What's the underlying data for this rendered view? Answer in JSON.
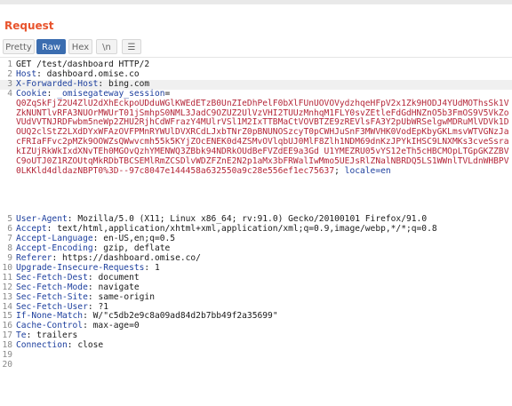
{
  "panel": {
    "title": "Request"
  },
  "toolbar": {
    "pretty_label": "Pretty",
    "raw_label": "Raw",
    "hex_label": "Hex",
    "newline_label": "\\n",
    "menu_label": "☰"
  },
  "request": {
    "request_line": "GET /test/dashboard HTTP/2",
    "headers": [
      {
        "num": "2",
        "name": "Host",
        "value": "dashboard.omise.co"
      },
      {
        "num": "3",
        "name": "X-Forwarded-Host",
        "value": "bing.com"
      }
    ],
    "cookie_name": "Cookie",
    "cookie_key": "_omisegateway_session",
    "cookie_value": "Q0ZqSkFjZ2U4ZlU2dXhEckpoUDduWGlKWEdETzB0UnZIeDhPelF0bXlFUnUOVOVydzhqeHFpV2x1Zk9HODJ4YUdMOThsSk1VZkNUNTlvRFA3NUOrMWUrT01jSmhpS0NML3JadC9OZUZ2UlVzVHI2TUUzMnhqM1FLY0svZEtleFdGdHNZnO5b3FmOS9V5VkZoVUdVVTNJRDFwbm5neWp2ZHU2RjhCdWFrazY4MUlrVSl1M2IxTTBMaCtVOVBTZE9zREVlsFA3Y2pUbWRSelgwMDRuMlVDVk1DOUQ2clStZ2LXdDYxWFAzOVFPMnRYWUlDVXRCdLJxbTNrZ0pBNUNOSzcyT0pCWHJuSnF3MWVHK0VodEpKbyGKLmsvWTVGNzJacFRIaFFvc2pMZk9OOWZsQWwvcmh55k5KYjZOcENEK0d4ZSMvOVlqbUJ0MlF8Zlh1NDM69dnKzJPYkIHSC9LNXMKs3cveSsrakIZUjRkWkIxdXNvTEh0MGOvQzhYMENWQ3ZBbk94NDRkOUdBeFVZdEE9a3Gd U1YMEZRU05vYS12eTh5cHBCMOpLTGpGKZZBVC9oUTJ0Z1RZOUtqMkRDbTBCSEMlRmZCSDlvWDZFZnE2N2p1aMx3bFRWalIwMmo5UEJsRlZNalNBRDQ5LS1WWnlTVLdnWHBPV0LKKld4dldaz"
  },
  "cookie_extra": [
    "NBPT0%3D--97c8047e144458a632550a9c28e556ef1ec75637",
    "locale=en"
  ],
  "headers_after": [
    {
      "num": "5",
      "name": "User-Agent",
      "value": "Mozilla/5.0 (X11; Linux x86_64; rv:91.0) Gecko/20100101 Firefox/91.0"
    },
    {
      "num": "6",
      "name": "Accept",
      "value": "text/html,application/xhtml+xml,application/xml;q=0.9,image/webp,*/*;q=0.8"
    },
    {
      "num": "7",
      "name": "Accept-Language",
      "value": "en-US,en;q=0.5"
    },
    {
      "num": "8",
      "name": "Accept-Encoding",
      "value": "gzip, deflate"
    },
    {
      "num": "9",
      "name": "Referer",
      "value": "https://dashboard.omise.co/"
    },
    {
      "num": "10",
      "name": "Upgrade-Insecure-Requests",
      "value": "1"
    },
    {
      "num": "11",
      "name": "Sec-Fetch-Dest",
      "value": "document"
    },
    {
      "num": "12",
      "name": "Sec-Fetch-Mode",
      "value": "navigate"
    },
    {
      "num": "13",
      "name": "Sec-Fetch-Site",
      "value": "same-origin"
    },
    {
      "num": "14",
      "name": "Sec-Fetch-User",
      "value": "?1"
    },
    {
      "num": "15",
      "name": "If-None-Match",
      "value": "W/\"c5db2e9c8a09ad84d2b7bb49f2a35699\""
    },
    {
      "num": "16",
      "name": "Cache-Control",
      "value": "max-age=0"
    },
    {
      "num": "17",
      "name": "Te",
      "value": "trailers"
    },
    {
      "num": "18",
      "name": "Connection",
      "value": "close"
    }
  ],
  "empty_lines": [
    "19",
    "20"
  ],
  "line_numbers": {
    "first": "1",
    "cookie": "4"
  }
}
